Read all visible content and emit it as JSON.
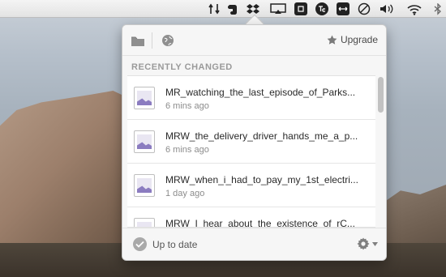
{
  "menubar": {
    "icons": [
      "transfer-arrows-icon",
      "evernote-icon",
      "dropbox-icon",
      "airplay-icon",
      "command-icon",
      "te-icon",
      "resize-icon",
      "do-not-disturb-icon",
      "volume-icon",
      "wifi-icon",
      "bluetooth-icon"
    ]
  },
  "popover": {
    "header": {
      "upgrade_label": "Upgrade"
    },
    "section_title": "RECENTLY CHANGED",
    "files": [
      {
        "name": "MR_watching_the_last_episode_of_Parks...",
        "time": "6 mins ago"
      },
      {
        "name": "MRW_the_delivery_driver_hands_me_a_p...",
        "time": "6 mins ago"
      },
      {
        "name": "MRW_when_i_had_to_pay_my_1st_electri...",
        "time": "1 day ago"
      },
      {
        "name": "MRW_I_hear_about_the_existence_of_rC...",
        "time": ""
      }
    ],
    "footer": {
      "status": "Up to date"
    }
  },
  "colors": {
    "accent_purple": "#8b7cc0",
    "popover_bg": "#f6f6f6",
    "muted_text": "#8c8c8c"
  }
}
